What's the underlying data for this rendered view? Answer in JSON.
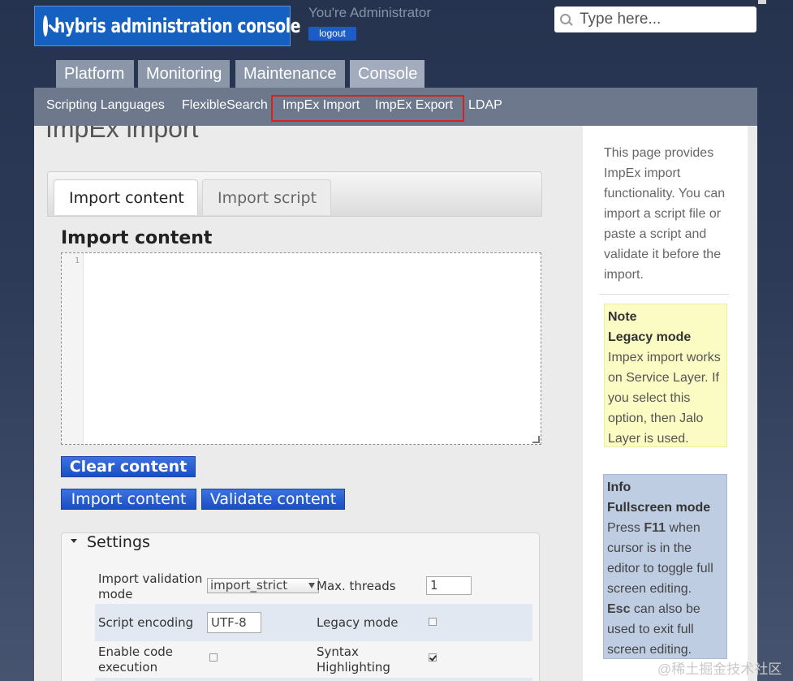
{
  "header": {
    "logo_text": "hybris administration console",
    "admin_text": "You're Administrator",
    "logout_label": "logout",
    "search_placeholder": "Type here..."
  },
  "main_tabs": [
    {
      "label": "Platform",
      "active": false
    },
    {
      "label": "Monitoring",
      "active": false
    },
    {
      "label": "Maintenance",
      "active": false
    },
    {
      "label": "Console",
      "active": true
    }
  ],
  "sub_nav": [
    "Scripting Languages",
    "FlexibleSearch",
    "ImpEx Import",
    "ImpEx Export",
    "LDAP"
  ],
  "page_title": "ImpEx import",
  "tabs": {
    "active": "Import content",
    "inactive": "Import script"
  },
  "section_heading": "Import content",
  "editor": {
    "line_number": "1"
  },
  "buttons": {
    "clear": "Clear content",
    "import": "Import content",
    "validate": "Validate content"
  },
  "settings": {
    "title": "Settings",
    "validation_mode_label": "Import validation mode",
    "validation_mode_value": "import_strict",
    "max_threads_label": "Max. threads",
    "max_threads_value": "1",
    "encoding_label": "Script encoding",
    "encoding_value": "UTF-8",
    "legacy_mode_label": "Legacy mode",
    "legacy_mode_checked": false,
    "code_exec_label": "Enable code execution",
    "code_exec_checked": false,
    "syntax_label": "Syntax Highlighting",
    "syntax_checked": true
  },
  "sidebar": {
    "description": "This page provides ImpEx import functionality. You can import a script file or paste a script and validate it before the import.",
    "note_title": "Note",
    "note_heading": "Legacy mode",
    "note_text": "Impex import works on Service Layer. If you select this option, then Jalo Layer is used.",
    "info_title": "Info",
    "info_heading": "Fullscreen mode",
    "info_press": "Press",
    "info_key1": "F11",
    "info_text1": "when cursor is in the editor to toggle full screen editing.",
    "info_key2": "Esc",
    "info_text2": "can also be used to exit full screen editing."
  },
  "watermark": "@稀土掘金技术社区",
  "colors": {
    "highlight_border": "#d8201f",
    "button_blue": "#2a5fd4",
    "note_bg": "#fbfbc4",
    "info_bg": "#bfcde3"
  }
}
